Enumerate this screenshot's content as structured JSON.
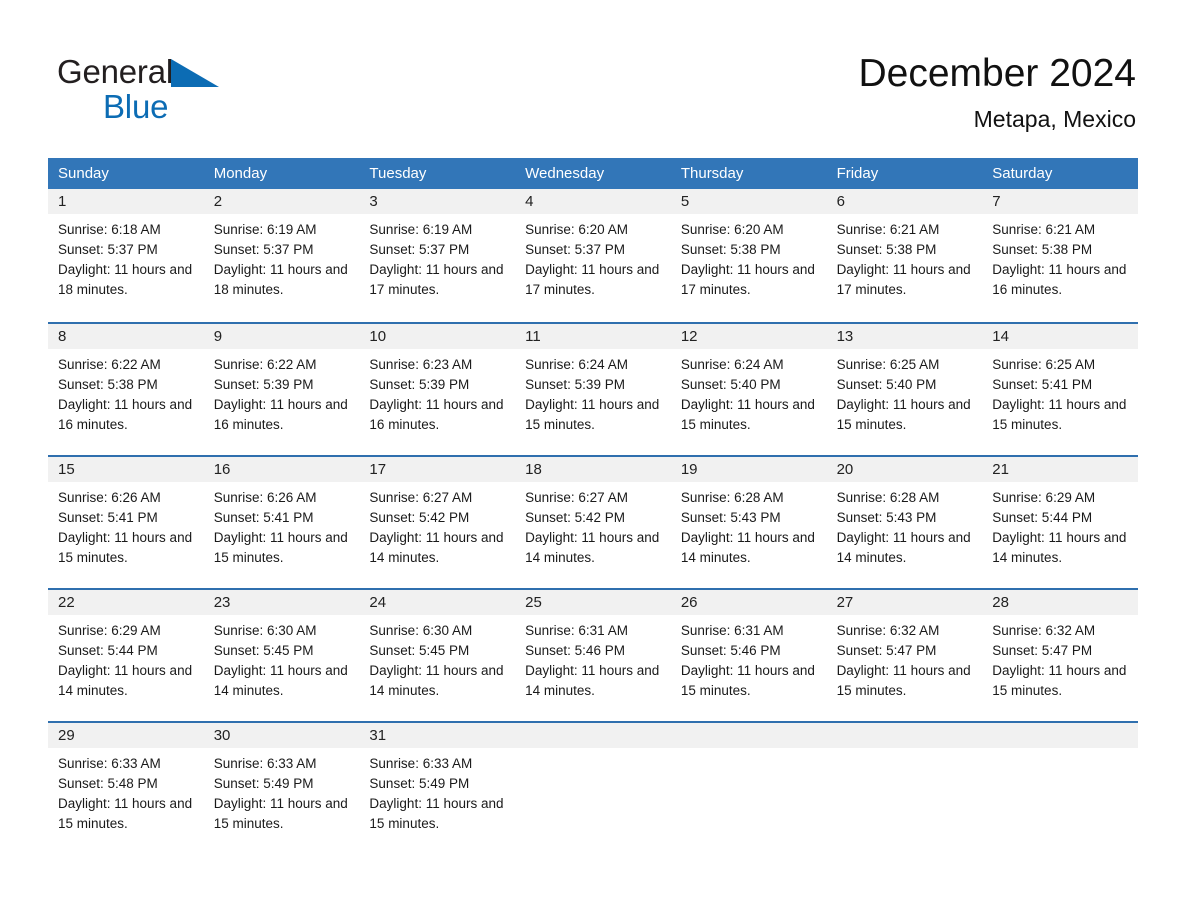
{
  "brand": {
    "name_part1": "General",
    "name_part2": "Blue",
    "triangle_color": "#0c6cb4",
    "text_color": "#231f20"
  },
  "header": {
    "title": "December 2024",
    "subtitle": "Metapa, Mexico",
    "header_bg_color": "#3276b8",
    "row_border_color": "#2f6fae",
    "day_number_bg": "#f1f1f1"
  },
  "weekdays": [
    "Sunday",
    "Monday",
    "Tuesday",
    "Wednesday",
    "Thursday",
    "Friday",
    "Saturday"
  ],
  "labels": {
    "sunrise_prefix": "Sunrise:",
    "sunset_prefix": "Sunset:",
    "daylight_prefix": "Daylight:"
  },
  "weeks": [
    [
      {
        "day": "1",
        "sunrise": "Sunrise: 6:18 AM",
        "sunset": "Sunset: 5:37 PM",
        "daylight": "Daylight: 11 hours and 18 minutes."
      },
      {
        "day": "2",
        "sunrise": "Sunrise: 6:19 AM",
        "sunset": "Sunset: 5:37 PM",
        "daylight": "Daylight: 11 hours and 18 minutes."
      },
      {
        "day": "3",
        "sunrise": "Sunrise: 6:19 AM",
        "sunset": "Sunset: 5:37 PM",
        "daylight": "Daylight: 11 hours and 17 minutes."
      },
      {
        "day": "4",
        "sunrise": "Sunrise: 6:20 AM",
        "sunset": "Sunset: 5:37 PM",
        "daylight": "Daylight: 11 hours and 17 minutes."
      },
      {
        "day": "5",
        "sunrise": "Sunrise: 6:20 AM",
        "sunset": "Sunset: 5:38 PM",
        "daylight": "Daylight: 11 hours and 17 minutes."
      },
      {
        "day": "6",
        "sunrise": "Sunrise: 6:21 AM",
        "sunset": "Sunset: 5:38 PM",
        "daylight": "Daylight: 11 hours and 17 minutes."
      },
      {
        "day": "7",
        "sunrise": "Sunrise: 6:21 AM",
        "sunset": "Sunset: 5:38 PM",
        "daylight": "Daylight: 11 hours and 16 minutes."
      }
    ],
    [
      {
        "day": "8",
        "sunrise": "Sunrise: 6:22 AM",
        "sunset": "Sunset: 5:38 PM",
        "daylight": "Daylight: 11 hours and 16 minutes."
      },
      {
        "day": "9",
        "sunrise": "Sunrise: 6:22 AM",
        "sunset": "Sunset: 5:39 PM",
        "daylight": "Daylight: 11 hours and 16 minutes."
      },
      {
        "day": "10",
        "sunrise": "Sunrise: 6:23 AM",
        "sunset": "Sunset: 5:39 PM",
        "daylight": "Daylight: 11 hours and 16 minutes."
      },
      {
        "day": "11",
        "sunrise": "Sunrise: 6:24 AM",
        "sunset": "Sunset: 5:39 PM",
        "daylight": "Daylight: 11 hours and 15 minutes."
      },
      {
        "day": "12",
        "sunrise": "Sunrise: 6:24 AM",
        "sunset": "Sunset: 5:40 PM",
        "daylight": "Daylight: 11 hours and 15 minutes."
      },
      {
        "day": "13",
        "sunrise": "Sunrise: 6:25 AM",
        "sunset": "Sunset: 5:40 PM",
        "daylight": "Daylight: 11 hours and 15 minutes."
      },
      {
        "day": "14",
        "sunrise": "Sunrise: 6:25 AM",
        "sunset": "Sunset: 5:41 PM",
        "daylight": "Daylight: 11 hours and 15 minutes."
      }
    ],
    [
      {
        "day": "15",
        "sunrise": "Sunrise: 6:26 AM",
        "sunset": "Sunset: 5:41 PM",
        "daylight": "Daylight: 11 hours and 15 minutes."
      },
      {
        "day": "16",
        "sunrise": "Sunrise: 6:26 AM",
        "sunset": "Sunset: 5:41 PM",
        "daylight": "Daylight: 11 hours and 15 minutes."
      },
      {
        "day": "17",
        "sunrise": "Sunrise: 6:27 AM",
        "sunset": "Sunset: 5:42 PM",
        "daylight": "Daylight: 11 hours and 14 minutes."
      },
      {
        "day": "18",
        "sunrise": "Sunrise: 6:27 AM",
        "sunset": "Sunset: 5:42 PM",
        "daylight": "Daylight: 11 hours and 14 minutes."
      },
      {
        "day": "19",
        "sunrise": "Sunrise: 6:28 AM",
        "sunset": "Sunset: 5:43 PM",
        "daylight": "Daylight: 11 hours and 14 minutes."
      },
      {
        "day": "20",
        "sunrise": "Sunrise: 6:28 AM",
        "sunset": "Sunset: 5:43 PM",
        "daylight": "Daylight: 11 hours and 14 minutes."
      },
      {
        "day": "21",
        "sunrise": "Sunrise: 6:29 AM",
        "sunset": "Sunset: 5:44 PM",
        "daylight": "Daylight: 11 hours and 14 minutes."
      }
    ],
    [
      {
        "day": "22",
        "sunrise": "Sunrise: 6:29 AM",
        "sunset": "Sunset: 5:44 PM",
        "daylight": "Daylight: 11 hours and 14 minutes."
      },
      {
        "day": "23",
        "sunrise": "Sunrise: 6:30 AM",
        "sunset": "Sunset: 5:45 PM",
        "daylight": "Daylight: 11 hours and 14 minutes."
      },
      {
        "day": "24",
        "sunrise": "Sunrise: 6:30 AM",
        "sunset": "Sunset: 5:45 PM",
        "daylight": "Daylight: 11 hours and 14 minutes."
      },
      {
        "day": "25",
        "sunrise": "Sunrise: 6:31 AM",
        "sunset": "Sunset: 5:46 PM",
        "daylight": "Daylight: 11 hours and 14 minutes."
      },
      {
        "day": "26",
        "sunrise": "Sunrise: 6:31 AM",
        "sunset": "Sunset: 5:46 PM",
        "daylight": "Daylight: 11 hours and 15 minutes."
      },
      {
        "day": "27",
        "sunrise": "Sunrise: 6:32 AM",
        "sunset": "Sunset: 5:47 PM",
        "daylight": "Daylight: 11 hours and 15 minutes."
      },
      {
        "day": "28",
        "sunrise": "Sunrise: 6:32 AM",
        "sunset": "Sunset: 5:47 PM",
        "daylight": "Daylight: 11 hours and 15 minutes."
      }
    ],
    [
      {
        "day": "29",
        "sunrise": "Sunrise: 6:33 AM",
        "sunset": "Sunset: 5:48 PM",
        "daylight": "Daylight: 11 hours and 15 minutes."
      },
      {
        "day": "30",
        "sunrise": "Sunrise: 6:33 AM",
        "sunset": "Sunset: 5:49 PM",
        "daylight": "Daylight: 11 hours and 15 minutes."
      },
      {
        "day": "31",
        "sunrise": "Sunrise: 6:33 AM",
        "sunset": "Sunset: 5:49 PM",
        "daylight": "Daylight: 11 hours and 15 minutes."
      },
      {
        "day": "",
        "sunrise": "",
        "sunset": "",
        "daylight": ""
      },
      {
        "day": "",
        "sunrise": "",
        "sunset": "",
        "daylight": ""
      },
      {
        "day": "",
        "sunrise": "",
        "sunset": "",
        "daylight": ""
      },
      {
        "day": "",
        "sunrise": "",
        "sunset": "",
        "daylight": ""
      }
    ]
  ]
}
